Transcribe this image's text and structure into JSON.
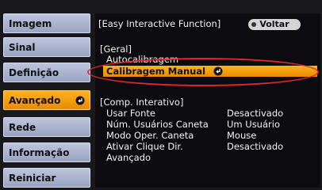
{
  "sidebar": {
    "items": [
      {
        "label": "Imagem"
      },
      {
        "label": "Sinal"
      },
      {
        "label": "Definição"
      },
      {
        "label": "Avançado",
        "active": true
      },
      {
        "label": "Rede"
      },
      {
        "label": "Informação"
      },
      {
        "label": "Reiniciar"
      }
    ]
  },
  "panel": {
    "title": "[Easy Interactive Function]",
    "back_label": "Voltar",
    "general_section": "[Geral]",
    "general_items": [
      "Autocalibragem",
      "Calibragem Manual"
    ],
    "comp_section": "[Comp. Interativo]",
    "settings": [
      {
        "label": "Usar Fonte",
        "value": "Desactivado"
      },
      {
        "label": "Núm. Usuários Caneta",
        "value": "Um Usuário"
      },
      {
        "label": "Modo Oper. Caneta",
        "value": "Mouse"
      },
      {
        "label": "Ativar Clique Dir.",
        "value": "Desactivado"
      }
    ],
    "advanced_label": "Avançado"
  },
  "colors": {
    "highlight": "#f39a00",
    "annotation": "#e3252c",
    "sidebar": "#aab2cf"
  }
}
